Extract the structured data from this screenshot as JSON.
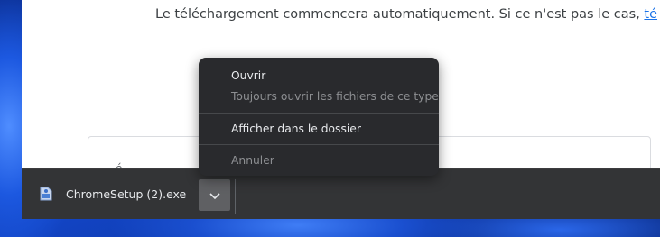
{
  "page": {
    "download_message": "Le téléchargement commencera automatiquement. Si ce n'est pas le cas,",
    "download_link": "té",
    "card_fragment": "é"
  },
  "download_shelf": {
    "file_name": "ChromeSetup (2).exe",
    "file_icon": "installer-file-icon",
    "menu_button_icon": "chevron-down-icon"
  },
  "context_menu": {
    "items": [
      {
        "label": "Ouvrir",
        "enabled": true
      },
      {
        "label": "Toujours ouvrir les fichiers de ce type",
        "enabled": false
      },
      {
        "label": "Afficher dans le dossier",
        "enabled": true
      },
      {
        "label": "Annuler",
        "enabled": false
      }
    ]
  },
  "colors": {
    "shelf_bg": "#333436",
    "menu_bg": "#292a2d",
    "link": "#1a73e8",
    "wallpaper": "#1244c4"
  }
}
